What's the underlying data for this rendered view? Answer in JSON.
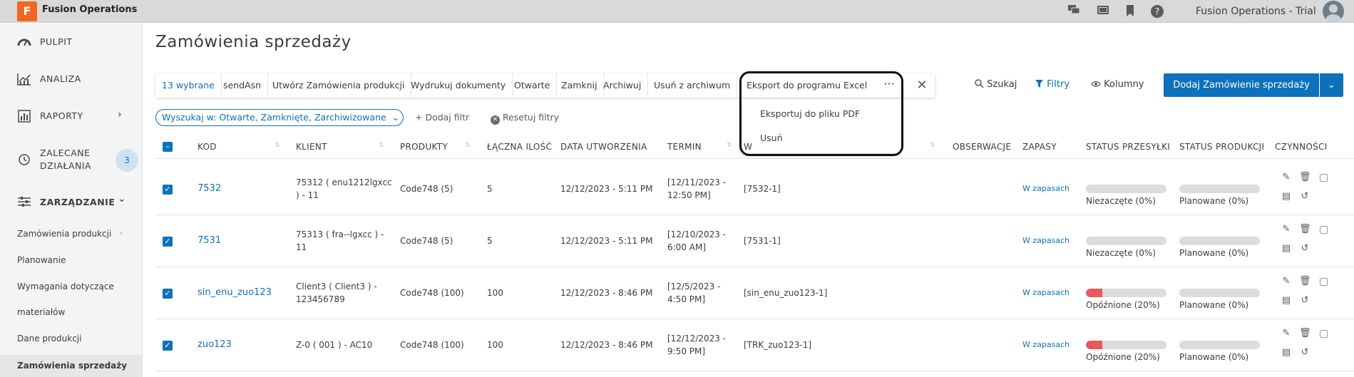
{
  "app": {
    "logo_letter": "F",
    "title": "Fusion Operations",
    "trial_label": "Fusion Operations - Trial"
  },
  "topbar": {
    "icons": [
      "chat-icon",
      "message-icon",
      "bookmark-icon",
      "help-icon"
    ],
    "help_glyph": "?"
  },
  "sidebar": {
    "items": [
      {
        "label": "PULPIT",
        "icon": "gauge-icon"
      },
      {
        "label": "ANALIZA",
        "icon": "chart-icon"
      },
      {
        "label": "RAPORTY",
        "icon": "report-icon",
        "arrow": "›"
      },
      {
        "label_line1": "ZALECANE",
        "label_line2": "DZIAŁANIA",
        "icon": "history-icon",
        "badge": "3"
      },
      {
        "label": "ZARZĄDZANIE",
        "icon": "sliders-icon",
        "arrow": "⌄"
      }
    ],
    "subitems": [
      {
        "label": "Zamówienia produkcji",
        "arrow": "›"
      },
      {
        "label": "Planowanie"
      },
      {
        "label": "Wymagania dotyczące"
      },
      {
        "label": "materiałów"
      },
      {
        "label": "Dane produkcji"
      },
      {
        "label": "Zamówienia sprzedaży",
        "arrow": "⌄"
      }
    ]
  },
  "page": {
    "title": "Zamówienia sprzedaży"
  },
  "toolbar": {
    "buttons": [
      "13 wybrane",
      "sendAsn",
      "Utwórz Zamówienia produkcji",
      "Wydrukuj dokumenty",
      "Otwarte",
      "Zamknij",
      "Archiwuj",
      "Usuń z archiwum",
      "Eksport do programu Excel"
    ],
    "more": "···",
    "close": "✕"
  },
  "more_menu": {
    "items": [
      "Eksportuj do pliku PDF",
      "Usuń"
    ]
  },
  "actions": {
    "search": "Szukaj",
    "filters": "Filtry",
    "columns": "Kolumny",
    "add": "Dodaj Zamówienie sprzedaży",
    "add_arrow": "⌄"
  },
  "filters": {
    "search_scope": "Wyszukaj w: Otwarte, Zamknięte, Zarchiwizowane",
    "add_filter": "+ Dodaj filtr",
    "reset": "Resetuj filtry"
  },
  "table": {
    "columns": [
      "KOD",
      "KLIENT",
      "PRODUKTY",
      "ŁĄCZNA ILOŚĆ",
      "DATA UTWORZENIA",
      "TERMIN",
      "W",
      "OBSERWACJE",
      "ZAPASY",
      "STATUS PRZESYŁKI",
      "STATUS PRODUKCJI",
      "CZYNNOŚCI"
    ],
    "rows": [
      {
        "code": "7532",
        "client_1": "75312 ( enu1212lgxcc",
        "client_2": ") - 11",
        "products": "Code748 (5)",
        "qty": "5",
        "created": "12/12/2023 - 5:11 PM",
        "due_1": "[12/11/2023 -",
        "due_2": "12:50 PM]",
        "ref": "[7532-1]",
        "stock": "W zapasach",
        "ship_status": "Niezaczęte (0%)",
        "ship_pct": 0,
        "prod_status": "Planowane (0%)",
        "prod_pct": 0
      },
      {
        "code": "7531",
        "client_1": "75313 ( fra--lgxcc ) -",
        "client_2": "11",
        "products": "Code748 (5)",
        "qty": "5",
        "created": "12/12/2023 - 5:11 PM",
        "due_1": "[12/10/2023 -",
        "due_2": "6:00 AM]",
        "ref": "[7531-1]",
        "stock": "W zapasach",
        "ship_status": "Niezaczęte (0%)",
        "ship_pct": 0,
        "prod_status": "Planowane (0%)",
        "prod_pct": 0
      },
      {
        "code": "sin_enu_zuo123",
        "client_1": "Client3 ( Client3 ) -",
        "client_2": "123456789",
        "products": "Code748 (100)",
        "qty": "100",
        "created": "12/12/2023 - 8:46 PM",
        "due_1": "[12/5/2023 -",
        "due_2": "4:50 PM]",
        "ref": "[sin_enu_zuo123-1]",
        "stock": "W zapasach",
        "ship_status": "Opóźnione (20%)",
        "ship_pct": 20,
        "prod_status": "Planowane (0%)",
        "prod_pct": 0
      },
      {
        "code": "zuo123",
        "client_1": "Z-0 ( 001 ) - AC10",
        "client_2": "",
        "products": "Code748 (100)",
        "qty": "100",
        "created": "12/12/2023 - 8:46 PM",
        "due_1": "[12/12/2023 -",
        "due_2": "9:50 PM]",
        "ref": "[TRK_zuo123-1]",
        "stock": "W zapasach",
        "ship_status": "Opóźnione (20%)",
        "ship_pct": 20,
        "prod_status": "Planowane (0%)",
        "prod_pct": 0
      }
    ]
  },
  "colors": {
    "accent": "#0d71bb",
    "delayed": "#e85a5a",
    "brand": "#f26622"
  }
}
